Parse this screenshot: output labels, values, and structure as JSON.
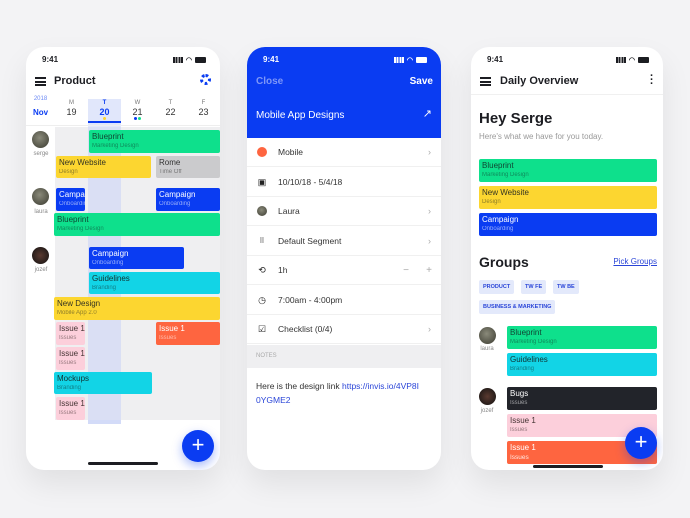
{
  "colors": {
    "accent": "#0a3cf2",
    "green": "#0ee08c",
    "yellow": "#fcd630",
    "cyan": "#12d4e6",
    "red": "#fe6540",
    "pink": "#fccfdb",
    "dark": "#22242a",
    "grey": "#cbcbcd"
  },
  "status_time": "9:41",
  "product": {
    "title": "Product",
    "settings_icon": "gear-icon",
    "menu_icon": "hamburger-icon",
    "year": "2018",
    "month": "Nov",
    "days": [
      {
        "l": "M",
        "n": "19"
      },
      {
        "l": "T",
        "n": "20"
      },
      {
        "l": "W",
        "n": "21"
      },
      {
        "l": "T",
        "n": "22"
      },
      {
        "l": "F",
        "n": "23"
      }
    ],
    "selected_day": "20",
    "people": [
      "serge",
      "laura",
      "jozef"
    ],
    "events": [
      {
        "t": "Blueprint",
        "s": "Marketing Design"
      },
      {
        "t": "New Website",
        "s": "Design"
      },
      {
        "t": "Rome",
        "s": "Time Off"
      },
      {
        "t": "Campaign",
        "s": "Onboarding"
      },
      {
        "t": "Campaign",
        "s": "Onboarding"
      },
      {
        "t": "Blueprint",
        "s": "Marketing Design"
      },
      {
        "t": "Campaign",
        "s": "Onboarding"
      },
      {
        "t": "Guidelines",
        "s": "Branding"
      },
      {
        "t": "New Design",
        "s": "Mobile App 2.0"
      },
      {
        "t": "Issue 1",
        "s": "Issues"
      },
      {
        "t": "Issue 1",
        "s": "Issues"
      },
      {
        "t": "Issue 1",
        "s": "Issues"
      },
      {
        "t": "Mockups",
        "s": "Branding"
      },
      {
        "t": "Issue 1",
        "s": "Issues"
      }
    ],
    "fab": "+"
  },
  "editor": {
    "close": "Close",
    "save": "Save",
    "title": "Mobile App Designs",
    "expand_icon": "arrow-diagonal-icon",
    "rows": [
      {
        "icon": "color-dot-icon",
        "label": "Mobile"
      },
      {
        "icon": "calendar-icon",
        "label": "10/10/18 - 5/4/18"
      },
      {
        "icon": "avatar",
        "label": "Laura"
      },
      {
        "icon": "grid-icon",
        "label": "Default Segment"
      },
      {
        "icon": "repeat-icon",
        "label": "1h"
      },
      {
        "icon": "clock-icon",
        "label": "7:00am - 4:00pm"
      },
      {
        "icon": "checklist-icon",
        "label": "Checklist (0/4)"
      }
    ],
    "minus": "−",
    "plus": "+",
    "notes_header": "NOTES",
    "notes_text": "Here is the design link ",
    "notes_link": "https://invis.io/4VP8I0YGME2"
  },
  "overview": {
    "title": "Daily Overview",
    "greeting": "Hey Serge",
    "subtitle": "Here's what we have for you today.",
    "today": [
      {
        "t": "Blueprint",
        "s": "Marketing Design"
      },
      {
        "t": "New Website",
        "s": "Design"
      },
      {
        "t": "Campaign",
        "s": "Onboarding"
      }
    ],
    "groups_title": "Groups",
    "pick_groups": "Pick Groups",
    "chips": [
      "PRODUCT",
      "TW FE",
      "TW BE",
      "BUSINESS & MARKETING"
    ],
    "people": [
      "laura",
      "jozef"
    ],
    "laura": [
      {
        "t": "Blueprint",
        "s": "Marketing Design"
      },
      {
        "t": "Guidelines",
        "s": "Branding"
      }
    ],
    "jozef": [
      {
        "t": "Bugs",
        "s": "Issues"
      },
      {
        "t": "Issue 1",
        "s": "Issues"
      },
      {
        "t": "Issue 1",
        "s": "Issues"
      }
    ],
    "fab": "+"
  }
}
